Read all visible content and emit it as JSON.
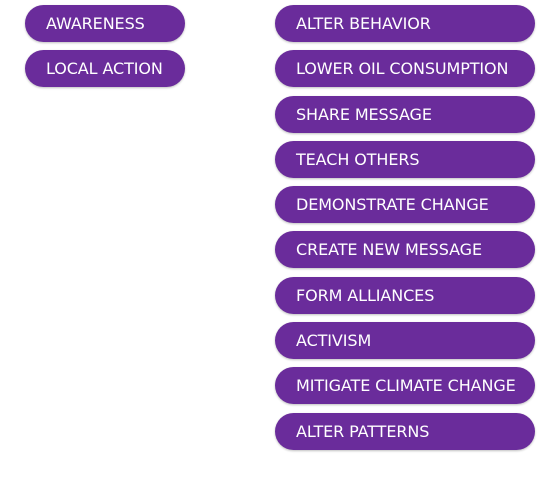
{
  "colors": {
    "pill_bg": "#6a2c9b",
    "pill_text": "#ffffff",
    "page_bg": "#ffffff"
  },
  "left_column": {
    "items": [
      {
        "label": "AWARENESS"
      },
      {
        "label": "LOCAL ACTION"
      }
    ]
  },
  "right_column": {
    "items": [
      {
        "label": "ALTER BEHAVIOR"
      },
      {
        "label": "LOWER OIL CONSUMPTION"
      },
      {
        "label": "SHARE MESSAGE"
      },
      {
        "label": "TEACH OTHERS"
      },
      {
        "label": "DEMONSTRATE CHANGE"
      },
      {
        "label": "CREATE NEW MESSAGE"
      },
      {
        "label": "FORM ALLIANCES"
      },
      {
        "label": "ACTIVISM"
      },
      {
        "label": "MITIGATE CLIMATE CHANGE"
      },
      {
        "label": "ALTER PATTERNS"
      }
    ]
  }
}
